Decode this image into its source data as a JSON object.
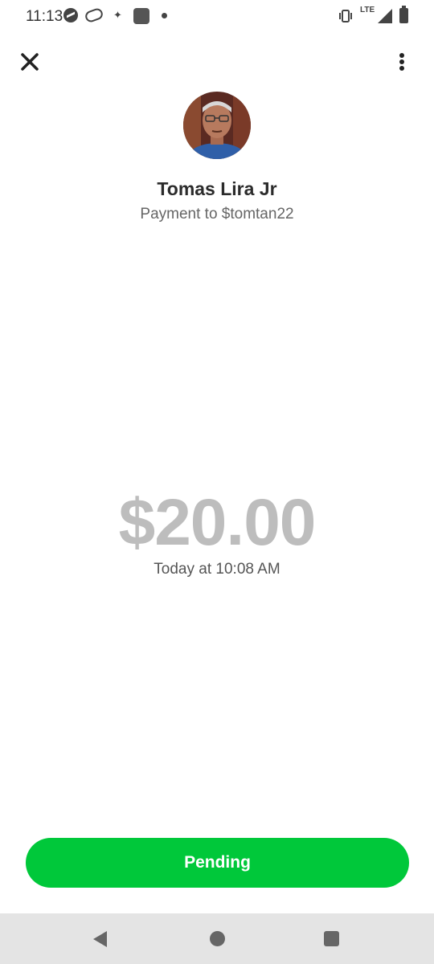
{
  "status_bar": {
    "time": "11:13",
    "network": "LTE",
    "icons": [
      "messenger-icon",
      "chain-link-icon",
      "sparkle-icon",
      "app-square-icon",
      "notification-dot-icon",
      "vibrate-icon",
      "signal-icon",
      "battery-icon"
    ]
  },
  "header": {
    "close_icon": "close-icon",
    "more_icon": "more-vert-icon"
  },
  "recipient": {
    "name": "Tomas Lira Jr",
    "subtitle": "Payment to $tomtan22"
  },
  "payment": {
    "amount": "$20.00",
    "timestamp": "Today at 10:08 AM",
    "status_label": "Pending"
  },
  "colors": {
    "accent": "#00c83a",
    "amount_text": "#bdbdbd"
  },
  "nav": {
    "icons": [
      "back-icon",
      "home-icon",
      "recents-icon"
    ]
  }
}
